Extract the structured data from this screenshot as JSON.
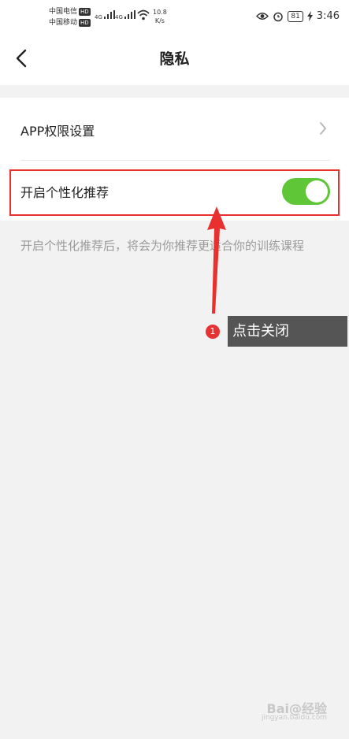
{
  "status_bar": {
    "carrier1": "中国电信",
    "carrier2": "中国移动",
    "hd_label": "HD",
    "signal_label": "4G",
    "net_speed": "10.8",
    "net_unit": "K/s",
    "battery": "81",
    "time": "3:46"
  },
  "header": {
    "title": "隐私",
    "back_icon": "chevron-left-icon"
  },
  "settings": {
    "app_permission_label": "APP权限设置",
    "personalized_label": "开启个性化推荐",
    "personalized_enabled": true,
    "description": "开启个性化推荐后，将会为你推荐更适合你的训练课程"
  },
  "annotation": {
    "step_number": "1",
    "callout_text": "点击关闭",
    "highlight_color": "#e8312f"
  },
  "watermark": {
    "brand": "Bai@经验",
    "sub": "jingyan.baidu.com"
  },
  "colors": {
    "toggle_on": "#5fc637",
    "background": "#f2f2f2"
  }
}
